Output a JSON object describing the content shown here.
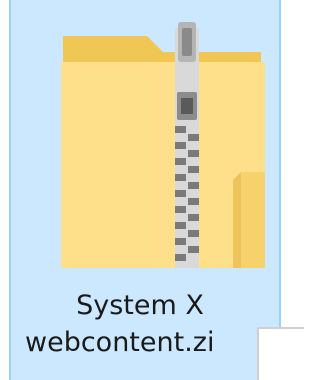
{
  "file": {
    "name_line1": "System X",
    "name_line2": "webcontent.zi",
    "icon": "zip-folder-icon"
  },
  "colors": {
    "selection_fill": "#cce8ff",
    "selection_border": "#99d1ff",
    "folder_back": "#f0c755",
    "folder_front": "#ffe08a",
    "zipper": "#9a9a9a"
  }
}
